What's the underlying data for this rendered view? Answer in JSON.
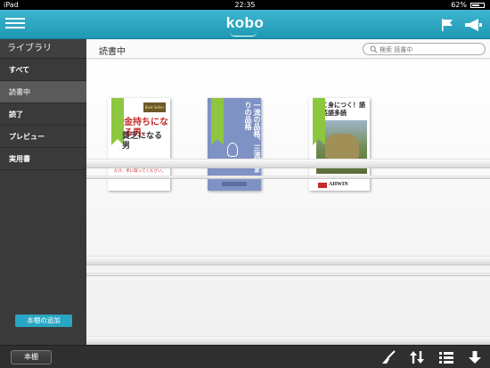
{
  "status_bar": {
    "carrier": "iPad",
    "time": "22:35",
    "battery": "62%"
  },
  "header": {
    "logo": "kobo"
  },
  "sidebar": {
    "title": "ライブラリ",
    "items": [
      {
        "label": "すべて"
      },
      {
        "label": "読書中"
      },
      {
        "label": "読了"
      },
      {
        "label": "プレビュー"
      },
      {
        "label": "実用書"
      }
    ],
    "add_shelf_label": "本棚の追加"
  },
  "main": {
    "title": "読書中",
    "search_placeholder": "検索 読書中"
  },
  "books": [
    {
      "tag": "Best Seller",
      "title_line1": "金持ちになる男、",
      "title_line2": "貧乏になる男",
      "blurb": "本当に お金持ちになりたい人だけ、手に取ってください。"
    },
    {
      "title": "一流の品格、三流どまりの品格"
    },
    {
      "title": "こ身につく！語英語多読",
      "brand": "AHWIN"
    }
  ],
  "bottom_bar": {
    "shelf_button": "本棚"
  },
  "colors": {
    "accent": "#29a6c4",
    "ribbon": "#8dc63f"
  }
}
